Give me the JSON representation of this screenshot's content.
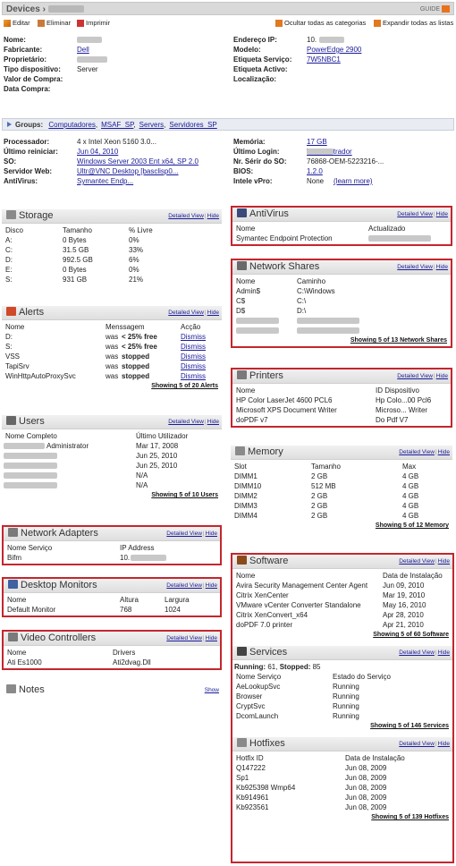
{
  "header": {
    "breadcrumb": "Devices ›",
    "guide": "GUIDE"
  },
  "toolbar": {
    "edit": "Editar",
    "delete": "Eliminar",
    "print": "Imprimir",
    "hide_cat": "Ocultar todas as categorias",
    "expand": "Expandir todas as listas"
  },
  "info_left": [
    {
      "label": "Nome:",
      "value": ""
    },
    {
      "label": "Fabricante:",
      "value": "Dell",
      "link": true
    },
    {
      "label": "Proprietário:",
      "value": ""
    },
    {
      "label": "Tipo dispositivo:",
      "value": "Server"
    },
    {
      "label": "Valor de Compra:",
      "value": ""
    },
    {
      "label": "Data Compra:",
      "value": ""
    }
  ],
  "info_right": [
    {
      "label": "Endereço IP:",
      "value": "10."
    },
    {
      "label": "Modelo:",
      "value": "PowerEdge 2900",
      "link": true
    },
    {
      "label": "Etiqueta Serviço:",
      "value": "7W5NBC1",
      "link": true
    },
    {
      "label": "Etiqueta Activo:",
      "value": ""
    },
    {
      "label": "Localização:",
      "value": ""
    }
  ],
  "groups": {
    "label": "Groups:",
    "items": [
      "Computadores",
      "MSAF_SP",
      "Servers",
      "Servidores_SP"
    ]
  },
  "hw_left": [
    {
      "label": "Processador:",
      "value": "4 x Intel Xeon 5160 3.0..."
    },
    {
      "label": "Último reiniciar:",
      "value": "Jun 04, 2010",
      "link": true
    },
    {
      "label": "SO:",
      "value": "Windows Server 2003 Ent x64, SP 2.0",
      "link": true
    },
    {
      "label": "Servidor Web:",
      "value": "Ultr@VNC Desktop [basclisp0...",
      "link": true
    },
    {
      "label": "AntiVirus:",
      "value": "Symantec Endp...",
      "link": true
    }
  ],
  "hw_right": [
    {
      "label": "Memória:",
      "value": "17 GB",
      "link": true
    },
    {
      "label": "Último Login:",
      "value": "\\administrador",
      "link": true
    },
    {
      "label": "Nr. Sérir do SO:",
      "value": "76868-OEM-5223216-..."
    },
    {
      "label": "BIOS:",
      "value": "1.2.0",
      "link": true
    },
    {
      "label": "Intele vPro:",
      "value": "None",
      "extra": "(learn more)"
    }
  ],
  "links": {
    "detailed": "Detailed View",
    "hide": "Hide",
    "show": "Show"
  },
  "storage": {
    "title": "Storage",
    "cols": [
      "Disco",
      "Tamanho",
      "% Livre"
    ],
    "rows": [
      [
        "A:",
        "0 Bytes",
        "0%"
      ],
      [
        "C:",
        "31.5 GB",
        "33%"
      ],
      [
        "D:",
        "992.5 GB",
        "6%"
      ],
      [
        "E:",
        "0 Bytes",
        "0%"
      ],
      [
        "S:",
        "931 GB",
        "21%"
      ]
    ]
  },
  "alerts": {
    "title": "Alerts",
    "cols": [
      "Nome",
      "Menssagem",
      "Acção"
    ],
    "rows": [
      [
        "D:",
        "was",
        "< 25% free",
        "Dismiss"
      ],
      [
        "S:",
        "was",
        "< 25% free",
        "Dismiss"
      ],
      [
        "VSS",
        "was",
        "stopped",
        "Dismiss"
      ],
      [
        "TapiSrv",
        "was",
        "stopped",
        "Dismiss"
      ],
      [
        "WinHttpAutoProxySvc",
        "was",
        "stopped",
        "Dismiss"
      ]
    ],
    "footer": "Showing 5 of 20 Alerts"
  },
  "users": {
    "title": "Users",
    "cols": [
      "Nome Completo",
      "Último Utilizador"
    ],
    "rows": [
      [
        "",
        "Administrator",
        "Mar 17, 2008"
      ],
      [
        "",
        "",
        "Jun 25, 2010"
      ],
      [
        "",
        "",
        "Jun 25, 2010"
      ],
      [
        "",
        "",
        "N/A"
      ],
      [
        "",
        "",
        "N/A"
      ]
    ],
    "footer": "Showing 5 of 10 Users"
  },
  "network_adapters": {
    "title": "Network Adapters",
    "cols": [
      "Nome Serviço",
      "IP Address"
    ],
    "rows": [
      [
        "Bifm",
        "10."
      ]
    ]
  },
  "desktop_monitors": {
    "title": "Desktop Monitors",
    "cols": [
      "Nome",
      "Altura",
      "Largura"
    ],
    "rows": [
      [
        "Default Monitor",
        "768",
        "1024"
      ]
    ]
  },
  "video": {
    "title": "Video Controllers",
    "cols": [
      "Nome",
      "Drivers"
    ],
    "rows": [
      [
        "Ati Es1000",
        "Ati2dvag.Dll"
      ]
    ]
  },
  "notes": {
    "title": "Notes"
  },
  "antivirus": {
    "title": "AntiVirus",
    "cols": [
      "Nome",
      "Actualizado"
    ],
    "rows": [
      [
        "Symantec Endpoint Protection",
        ""
      ]
    ]
  },
  "shares": {
    "title": "Network Shares",
    "cols": [
      "Nome",
      "Caminho"
    ],
    "rows": [
      [
        "Admin$",
        "C:\\Windows"
      ],
      [
        "C$",
        "C:\\"
      ],
      [
        "D$",
        "D:\\"
      ],
      [
        "",
        ""
      ],
      [
        "",
        ""
      ]
    ],
    "footer": "Showing 5 of 13 Network Shares"
  },
  "printers": {
    "title": "Printers",
    "cols": [
      "Nome",
      "ID Dispositivo"
    ],
    "rows": [
      [
        "HP Color LaserJet 4600 PCL6",
        "Hp Colo...00 Pcl6"
      ],
      [
        "Microsoft XPS Document Writer",
        "Microso... Writer"
      ],
      [
        "doPDF v7",
        "Do Pdf V7"
      ]
    ]
  },
  "memory": {
    "title": "Memory",
    "cols": [
      "Slot",
      "Tamanho",
      "Max"
    ],
    "rows": [
      [
        "DIMM1",
        "2 GB",
        "4 GB"
      ],
      [
        "DIMM10",
        "512 MB",
        "4 GB"
      ],
      [
        "DIMM2",
        "2 GB",
        "4 GB"
      ],
      [
        "DIMM3",
        "2 GB",
        "4 GB"
      ],
      [
        "DIMM4",
        "2 GB",
        "4 GB"
      ]
    ],
    "footer": "Showing 5 of 12 Memory"
  },
  "software": {
    "title": "Software",
    "cols": [
      "Nome",
      "Data de Instalação"
    ],
    "rows": [
      [
        "Avira Security Management Center Agent",
        "Jun 09, 2010"
      ],
      [
        "Citrix XenCenter",
        "Mar 19, 2010"
      ],
      [
        "VMware vCenter Converter Standalone",
        "May 16, 2010"
      ],
      [
        "Citrix XenConvert_x64",
        "Apr 28, 2010"
      ],
      [
        "doPDF 7.0 printer",
        "Apr 21, 2010"
      ]
    ],
    "footer": "Showing 5 of 60 Software"
  },
  "services": {
    "title": "Services",
    "summary_a": "Running:",
    "summary_b": "61,",
    "summary_c": "Stopped:",
    "summary_d": "85",
    "cols": [
      "Nome Serviço",
      "Estado do Serviço"
    ],
    "rows": [
      [
        "AeLookupSvc",
        "Running"
      ],
      [
        "Browser",
        "Running"
      ],
      [
        "CryptSvc",
        "Running"
      ],
      [
        "DcomLaunch",
        "Running"
      ]
    ],
    "footer": "Showing 5 of 146 Services"
  },
  "hotfixes": {
    "title": "Hotfixes",
    "cols": [
      "Hotfix ID",
      "Data de Instalação"
    ],
    "rows": [
      [
        "Q147222",
        "Jun 08, 2009"
      ],
      [
        "Sp1",
        "Jun 08, 2009"
      ],
      [
        "Kb925398 Wmp64",
        "Jun 08, 2009"
      ],
      [
        "Kb914961",
        "Jun 08, 2009"
      ],
      [
        "Kb923561",
        "Jun 08, 2009"
      ]
    ],
    "footer": "Showing 5 of 139 Hotfixes"
  }
}
